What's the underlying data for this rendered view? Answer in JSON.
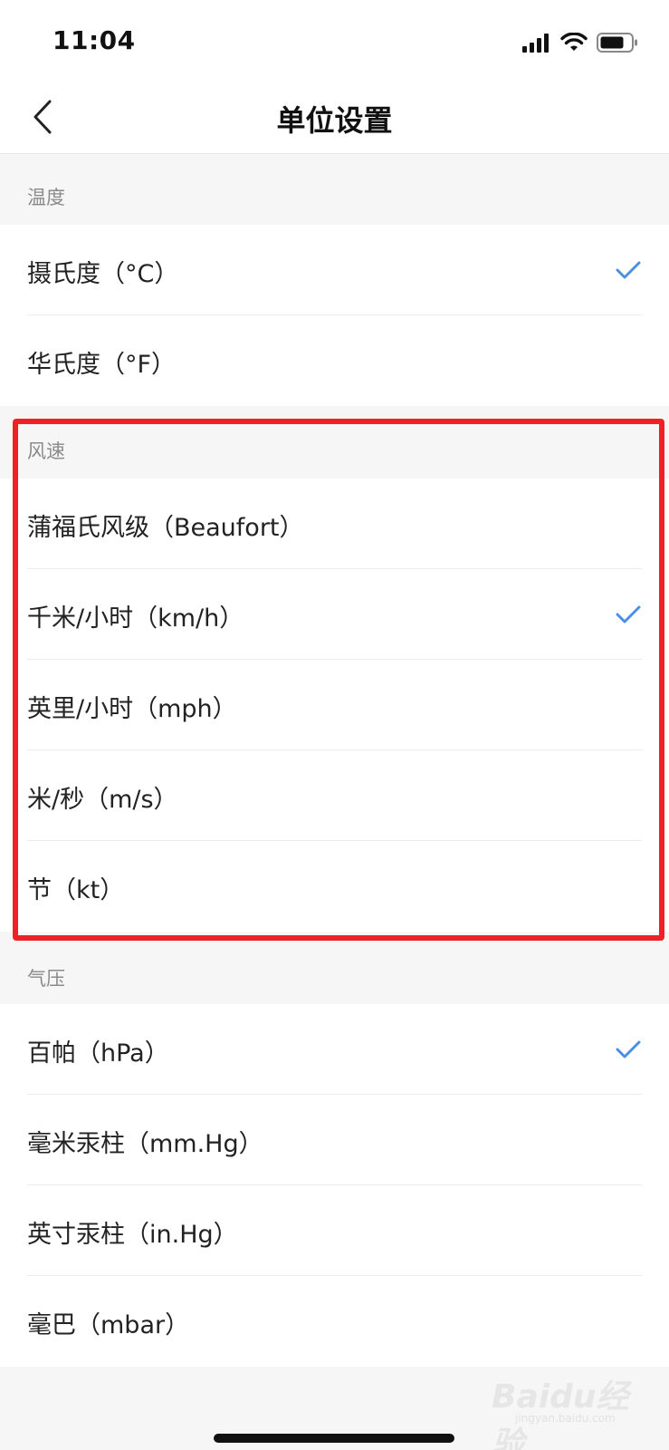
{
  "status_bar": {
    "time": "11:04"
  },
  "nav": {
    "title": "单位设置"
  },
  "sections": {
    "temperature": {
      "header": "温度",
      "items": [
        {
          "label": "摄氏度（°C）",
          "selected": true
        },
        {
          "label": "华氏度（°F）",
          "selected": false
        }
      ]
    },
    "wind": {
      "header": "风速",
      "items": [
        {
          "label": "蒲福氏风级（Beaufort）",
          "selected": false
        },
        {
          "label": "千米/小时（km/h）",
          "selected": true
        },
        {
          "label": "英里/小时（mph）",
          "selected": false
        },
        {
          "label": "米/秒（m/s）",
          "selected": false
        },
        {
          "label": "节（kt）",
          "selected": false
        }
      ]
    },
    "pressure": {
      "header": "气压",
      "items": [
        {
          "label": "百帕（hPa）",
          "selected": true
        },
        {
          "label": "毫米汞柱（mm.Hg）",
          "selected": false
        },
        {
          "label": "英寸汞柱（in.Hg）",
          "selected": false
        },
        {
          "label": "毫巴（mbar）",
          "selected": false
        }
      ]
    }
  },
  "watermark": {
    "text": "Baidu经验",
    "sub": "jingyan.baidu.com"
  },
  "colors": {
    "accent": "#4a90e2",
    "highlight": "#ee2222"
  }
}
